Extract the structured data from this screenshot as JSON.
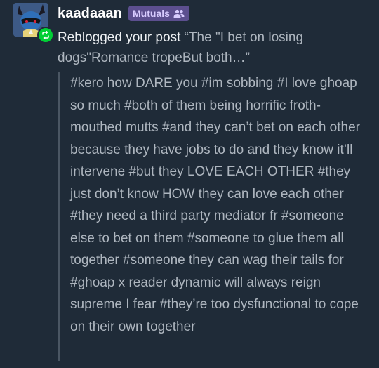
{
  "activity": {
    "username": "kaadaaan",
    "mutuals_label": "Mutuals",
    "summary_action": "Reblogged your post",
    "summary_quote": "“The \"I bet on losing dogs\"Romance tropeBut both…”",
    "tags": "#kero how DARE you #im sobbing #I love ghoap so much #both of them being horrific froth-mouthed mutts #and they can’t bet on each other because they have jobs to do and they know it’ll intervene #but they LOVE EACH OTHER #they just don’t know HOW they can love each other #they need a third party mediator fr #someone else to bet on them #someone to glue them all together #someone they can wag their tails for #ghoap x reader dynamic will always reign supreme I fear #they’re too dysfunctional to cope on their own together",
    "icons": {
      "avatar": "lucario-avatar",
      "reblog": "reblog-icon",
      "mutuals": "mutuals-icon"
    }
  },
  "colors": {
    "background": "#1f2b38",
    "reblog_green": "#00cf35",
    "mutuals_bg": "#5c4f8f",
    "mutuals_text": "#d8ccff",
    "tag_text": "#aeb6bf"
  }
}
